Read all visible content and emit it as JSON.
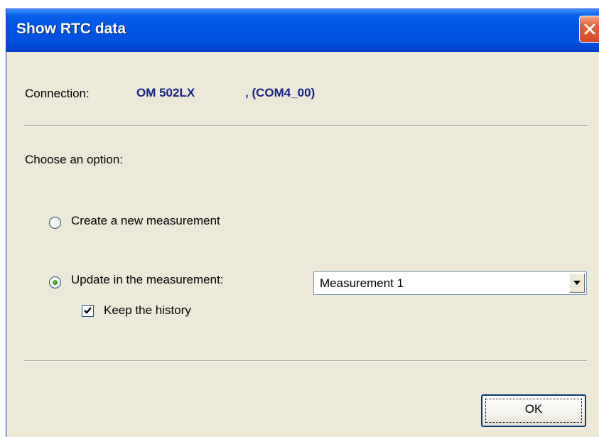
{
  "window": {
    "title": "Show RTC data"
  },
  "connection": {
    "label": "Connection:",
    "device": "OM 502LX",
    "port": ", (COM4_00)"
  },
  "options": {
    "prompt": "Choose an option:",
    "create_new": {
      "label": "Create a new measurement",
      "selected": false
    },
    "update": {
      "label": "Update in the measurement:",
      "selected": true
    },
    "measurement_select": {
      "value": "Measurement 1"
    },
    "keep_history": {
      "label": "Keep the history",
      "checked": true
    }
  },
  "buttons": {
    "ok_label": "OK"
  },
  "colors": {
    "titlebar": "#0055e5",
    "dialog_bg": "#ece9d8",
    "connection_text": "#152389",
    "close_button": "#e2623c"
  },
  "icons": {
    "close": "close-icon",
    "dropdown": "chevron-down-icon",
    "check": "check-icon"
  }
}
